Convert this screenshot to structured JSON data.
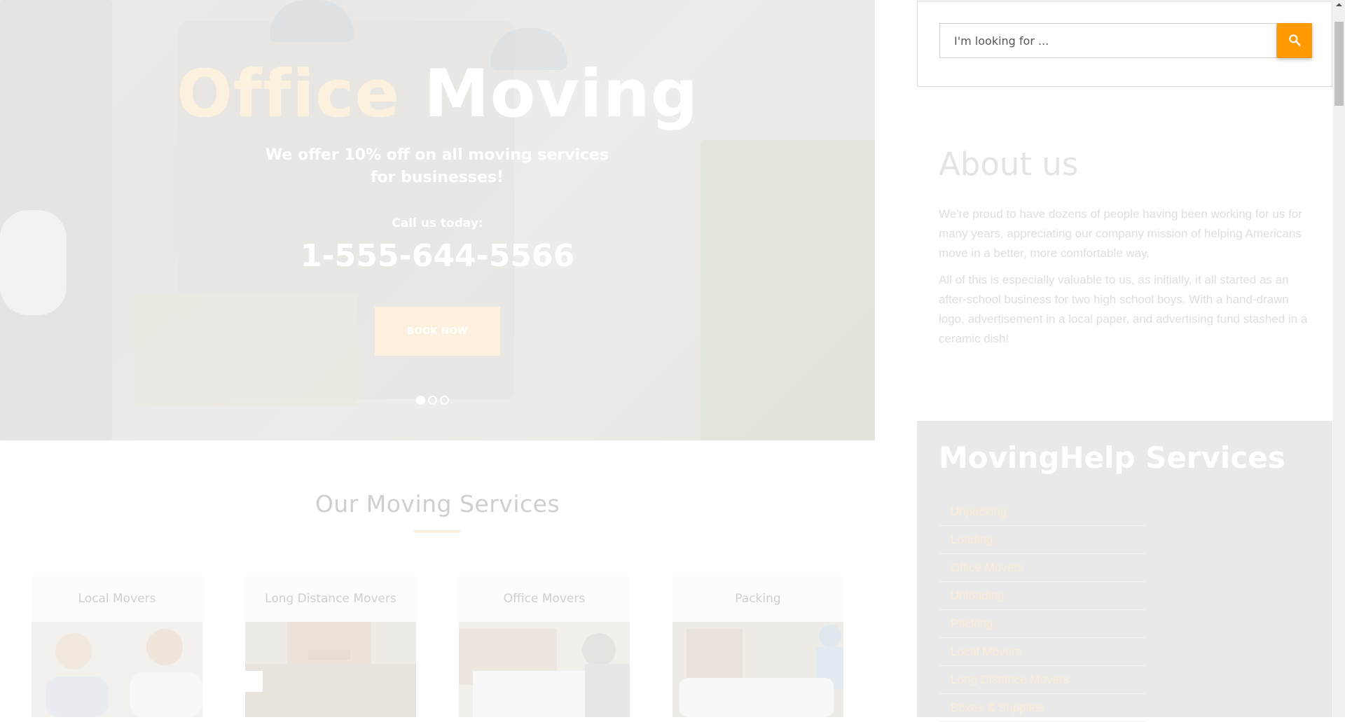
{
  "hero": {
    "title_word1": "Office",
    "title_word2": "Moving",
    "subtitle": "We offer 10% off on all moving services for businesses!",
    "call_label": "Call us today:",
    "phone": "1-555-644-5566",
    "button_label": "BOOK NOW",
    "slides": 3,
    "active_slide": 1,
    "accent_color": "#fcf1df"
  },
  "services_section": {
    "title": "Our Moving Services",
    "cards": [
      {
        "label": "Local Movers"
      },
      {
        "label": "Long Distance Movers"
      },
      {
        "label": "Office Movers"
      },
      {
        "label": "Packing"
      }
    ]
  },
  "search": {
    "placeholder": "I'm looking for ...",
    "button_icon": "search-icon",
    "button_color": "#ff9900"
  },
  "about": {
    "title": "About us",
    "p1": "We're proud to have dozens of people having been working for us for many years, appreciating our company mission of helping Americans move in a better, more comfortable way.",
    "p2": "All of this is especially valuable to us, as initially, it all started as an after-school business for two high school boys. With a hand-drawn logo, advertisement in a local paper, and advertising fund stashed in a ceramic dish!"
  },
  "sidebar_services": {
    "title": "MovingHelp Services",
    "items": [
      "Unpacking",
      "Loading",
      "Office Movers",
      "Unloading",
      "Packing",
      "Local Movers",
      "Long Distance Movers",
      "Boxes & Supplies"
    ]
  }
}
